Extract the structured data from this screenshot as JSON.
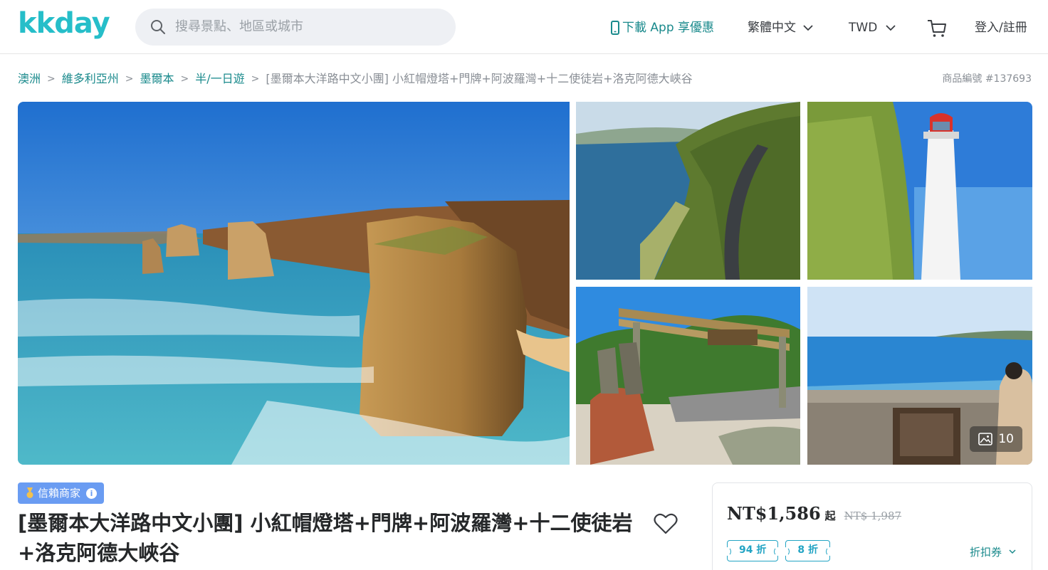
{
  "brand": {
    "logo_text": "kkday",
    "color": "#26bec9"
  },
  "header": {
    "search_placeholder": "搜尋景點、地區或城市",
    "app_label": "下載 App 享優惠",
    "language_label": "繁體中文",
    "currency_label": "TWD",
    "login_label": "登入/註冊"
  },
  "breadcrumb": {
    "items": [
      "澳洲",
      "維多利亞州",
      "墨爾本",
      "半/一日遊",
      "[墨爾本大洋路中文小團] 小紅帽燈塔+門牌+阿波羅灣+十二使徒岩+洛克阿德大峽谷"
    ],
    "product_number": "商品編號 #137693"
  },
  "gallery": {
    "photo_count": "10"
  },
  "product": {
    "badge": "信賴商家",
    "title": "[墨爾本大洋路中文小團] 小紅帽燈塔+門牌+阿波羅灣+十二使徒岩+洛克阿德大峽谷"
  },
  "pricing": {
    "price": "NT$1,586",
    "price_suffix": "起",
    "original_price": "NT$ 1,987",
    "discounts": [
      "94 折",
      "8 折"
    ],
    "coupon_label": "折扣券"
  },
  "colors": {
    "accent": "#1a8a8c",
    "badge": "#6a9cf2",
    "discount": "#23a4c4"
  }
}
